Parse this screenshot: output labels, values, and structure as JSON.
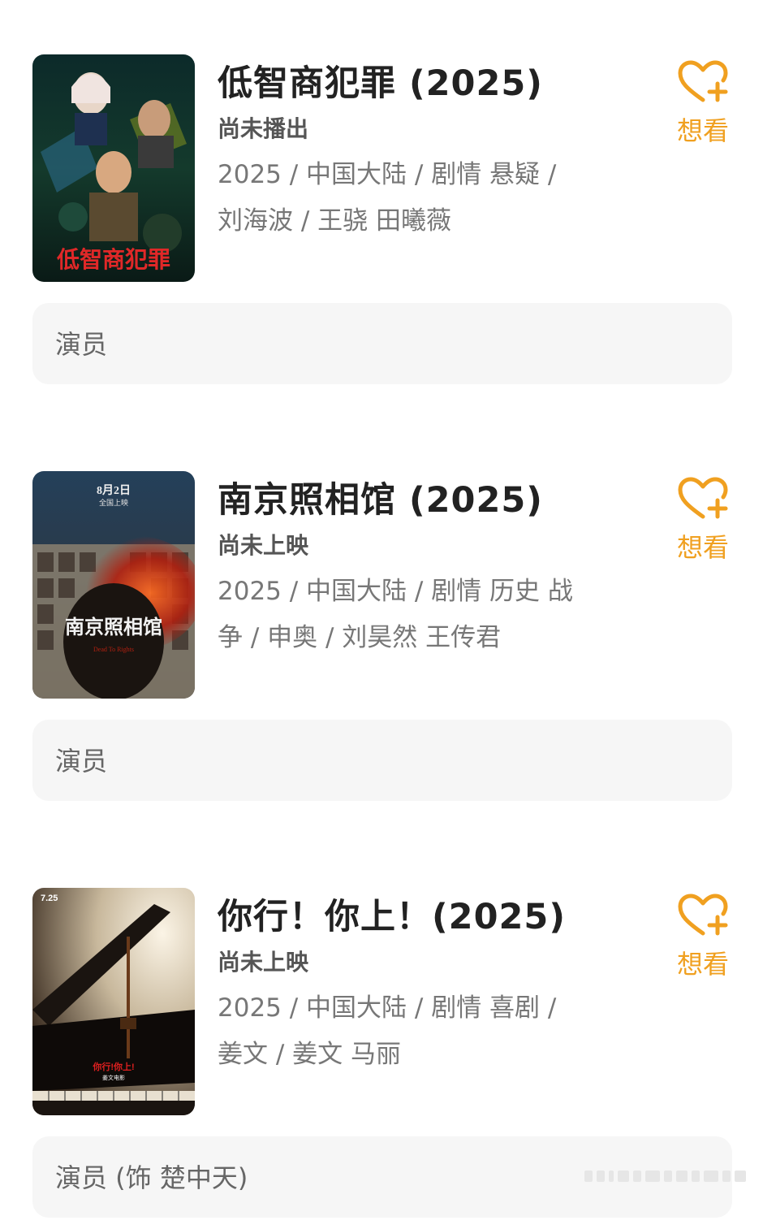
{
  "want_label": "想看",
  "accent_color": "#f0a020",
  "entries": [
    {
      "title": "低智商犯罪 (2025)",
      "status": "尚未播出",
      "meta": "2025 / 中国大陆 / 剧情 悬疑 / 刘海波 / 王骁 田曦薇",
      "poster_text": "低智商犯罪",
      "cast_label": "演员"
    },
    {
      "title": "南京照相馆 (2025)",
      "status": "尚未上映",
      "meta": "2025 / 中国大陆 / 剧情 历史 战争 / 申奥 / 刘昊然 王传君",
      "poster_text": "南京照相馆",
      "poster_date": "8月2日",
      "poster_release": "全国上映",
      "poster_en": "Dead To Rights",
      "cast_label": "演员"
    },
    {
      "title": "你行！你上！(2025)",
      "status": "尚未上映",
      "meta": "2025 / 中国大陆 / 剧情 喜剧 / 姜文 / 姜文 马丽",
      "poster_text": "你行!你上!",
      "poster_sub": "姜文电影",
      "poster_date": "7.25",
      "cast_label": "演员 (饰 楚中天)"
    }
  ]
}
